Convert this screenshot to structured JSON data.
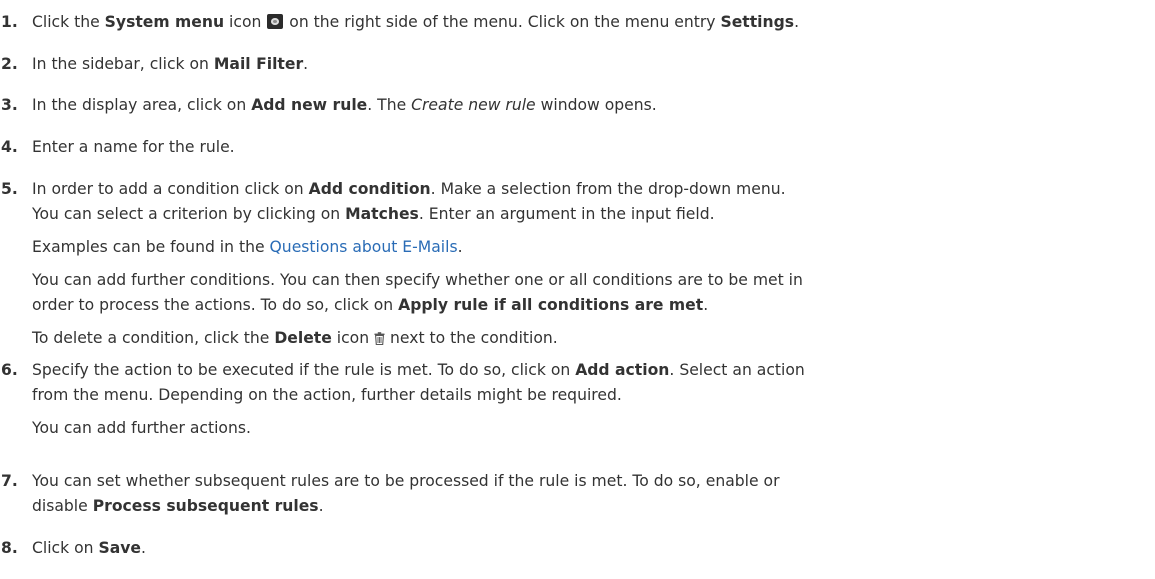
{
  "steps": [
    {
      "number": "1.",
      "lines": [
        {
          "parts": [
            "Click the ",
            "System menu",
            " icon ",
            " on the right side of the menu. Click on the menu entry ",
            "Settings",
            "."
          ]
        }
      ]
    },
    {
      "number": "2.",
      "lines": [
        {
          "parts": [
            "In the sidebar, click on ",
            "Mail Filter",
            "."
          ]
        }
      ]
    },
    {
      "number": "3.",
      "lines": [
        {
          "parts": [
            "In the display area, click on ",
            "Add new rule",
            ". The ",
            "Create new rule",
            " window opens."
          ]
        }
      ]
    },
    {
      "number": "4.",
      "lines": [
        {
          "parts": [
            "Enter a name for the rule."
          ]
        }
      ]
    },
    {
      "number": "5.",
      "lines": [
        {
          "parts": [
            "In order to add a condition click on ",
            "Add condition",
            ". Make a selection from the drop-down menu."
          ]
        },
        {
          "parts": [
            "You can select a criterion by clicking on ",
            "Matches",
            ". Enter an argument in the input field."
          ]
        },
        {
          "parts": [
            "Examples can be found in the ",
            "Questions about E-Mails",
            "."
          ]
        },
        {
          "parts": [
            "You can add further conditions. You can then specify whether one or all conditions are to be met in"
          ]
        },
        {
          "parts": [
            "order to process the actions. To do so, click on ",
            "Apply rule if all conditions are met",
            "."
          ]
        },
        {
          "parts": [
            "To delete a condition, click the ",
            "Delete",
            " icon ",
            " next to the condition."
          ]
        }
      ]
    },
    {
      "number": "6.",
      "lines": [
        {
          "parts": [
            "Specify the action to be executed if the rule is met. To do so, click on ",
            "Add action",
            ". Select an action"
          ]
        },
        {
          "parts": [
            "from the menu. Depending on the action, further details might be required."
          ]
        },
        {
          "parts": [
            "You can add further actions."
          ]
        }
      ]
    },
    {
      "number": "7.",
      "lines": [
        {
          "parts": [
            "You can set whether subsequent rules are to be processed if the rule is met. To do so, enable or"
          ]
        },
        {
          "parts": [
            "disable ",
            "Process subsequent rules",
            "."
          ]
        }
      ]
    },
    {
      "number": "8.",
      "lines": [
        {
          "parts": [
            "Click on ",
            "Save",
            "."
          ]
        }
      ]
    }
  ],
  "icons": {
    "system_menu": "system-menu-icon",
    "delete": "trash-icon"
  },
  "colors": {
    "text": "#333333",
    "link": "#2a6cb6"
  }
}
